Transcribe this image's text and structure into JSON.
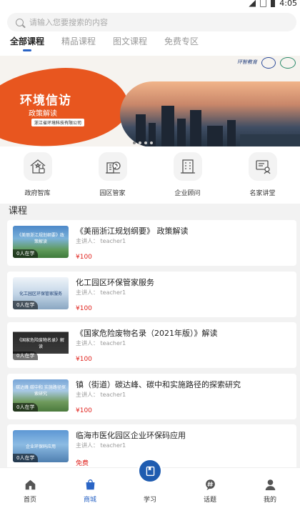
{
  "status_bar": {
    "time": "4:05"
  },
  "search": {
    "placeholder": "请输入您要搜索的内容"
  },
  "tabs": [
    {
      "label": "全部课程",
      "active": true
    },
    {
      "label": "精品课程",
      "active": false
    },
    {
      "label": "图文课程",
      "active": false
    },
    {
      "label": "免费专区",
      "active": false
    }
  ],
  "banner": {
    "headline": "环境信访",
    "subtitle": "政策解读",
    "company": "浙江省环境科技有限公司",
    "brand": "环智教育",
    "accent": "#e8561f"
  },
  "quick_links": [
    {
      "label": "政府智库",
      "icon": "government-house-icon"
    },
    {
      "label": "园区管家",
      "icon": "park-building-icon"
    },
    {
      "label": "企业顾问",
      "icon": "enterprise-building-icon"
    },
    {
      "label": "名家讲堂",
      "icon": "lecture-board-icon"
    }
  ],
  "section": {
    "title": "课程"
  },
  "courses": [
    {
      "title": "《美丽浙江规划纲要》 政策解读",
      "lecturer": "主讲人： teacher1",
      "price": "¥100",
      "learners": "0人在学",
      "thumb_text": "《美丽浙江规划纲要》政策解读"
    },
    {
      "title": "化工园区环保管家服务",
      "lecturer": "主讲人： teacher1",
      "price": "¥100",
      "learners": "0人在学",
      "thumb_text": "化工园区环保管家服务"
    },
    {
      "title": "《国家危险废物名录（2021年版）》解读",
      "lecturer": "主讲人： teacher1",
      "price": "¥100",
      "learners": "0人在学",
      "thumb_text": "《国家危险废物名录》解读"
    },
    {
      "title": "镇（街道）碳达峰、碳中和实施路径的探索研究",
      "lecturer": "主讲人： teacher1",
      "price": "¥100",
      "learners": "0人在学",
      "thumb_text": "碳达峰 碳中和 实施路径探索研究"
    },
    {
      "title": "临海市医化园区企业环保码应用",
      "lecturer": "主讲人： teacher1",
      "price": "免费",
      "learners": "0人在学",
      "thumb_text": "企业环保码应用"
    }
  ],
  "tabbar": [
    {
      "label": "首页",
      "icon": "home-icon",
      "active": false
    },
    {
      "label": "商城",
      "icon": "shopping-bag-icon",
      "active": true
    },
    {
      "label": "学习",
      "icon": "book-icon",
      "active": false
    },
    {
      "label": "话题",
      "icon": "topic-icon",
      "active": false
    },
    {
      "label": "我的",
      "icon": "user-icon",
      "active": false
    }
  ],
  "colors": {
    "primary": "#2a64c5",
    "price": "#e0231e"
  }
}
